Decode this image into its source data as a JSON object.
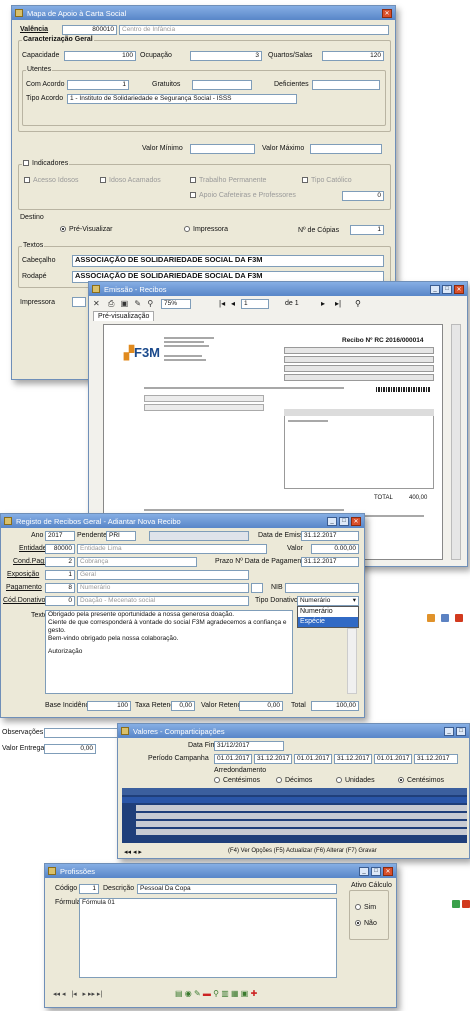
{
  "w1": {
    "title": "Mapa de Apoio à Carta Social",
    "valencia_label": "Valência",
    "valencia_code": "800010",
    "valencia_name": "Centro de Infância",
    "carac_label": "Caracterização Geral",
    "capacidade_label": "Capacidade",
    "capacidade": "100",
    "ocupacao_label": "Ocupação",
    "ocupacao": "3",
    "quartos_label": "Quartos/Salas",
    "quartos": "120",
    "utentes_label": "Utentes",
    "com_acordo_label": "Com Acordo",
    "com_acordo": "1",
    "gratuitos_label": "Gratuitos",
    "deficientes_label": "Deficientes",
    "tipo_acordo_label": "Tipo Acordo",
    "tipo_acordo": "1 - Instituto de Solidariedade e Segurança Social - ISSS",
    "valor_minimo_label": "Valor Mínimo",
    "valor_maximo_label": "Valor Máximo",
    "indicadores_label": "Indicadores",
    "ind1": "Acesso Idosos",
    "ind2": "Idoso Acamados",
    "ind3": "Trabalho Permanente",
    "ind4": "Tipo Católico",
    "ind5": "Apoio Cafeteiras e Professores",
    "ind_value": "0",
    "destino_label": "Destino",
    "pre_visualizar": "Pré-Visualizar",
    "impressora_opt": "Impressora",
    "copias_label": "Nº de Cópias",
    "copias": "1",
    "textos_label": "Textos",
    "cabecalho_label": "Cabeçalho",
    "cabecalho": "ASSOCIAÇÃO DE SOLIDARIEDADE SOCIAL DA F3M",
    "rodape_label": "Rodapé",
    "rodape": "ASSOCIAÇÃO DE SOLIDARIEDADE SOCIAL DA F3M",
    "impressora_label": "Impressora"
  },
  "w2": {
    "title": "Emissão - Recibos",
    "zoom": "75%",
    "page": "1",
    "pages": "de 1",
    "tab": "Pré-visualização",
    "logo": "F3M",
    "doc_title": "Recibo Nº",
    "doc_number": "RC 2016/000014",
    "total_label": "TOTAL",
    "total": "400,00"
  },
  "w3": {
    "title": "Registo de Recibos Geral - Adiantar Nova Recibo",
    "ano_label": "Ano",
    "ano": "2017",
    "estado_label": "Estado",
    "estado": "Pendente",
    "serie": "PRI",
    "data_emissao_label": "Data de Emissão",
    "data_emissao": "31.12.2017",
    "entidade_label": "Entidade",
    "entidade_code": "80000",
    "entidade_name": "Entidade Lima",
    "valor_label": "Valor",
    "valor": "0.00,00",
    "cond_pag_label": "Cond.Pag.",
    "cond_pag_code": "2",
    "cond_pag_name": "Cobrança",
    "prazo_label": "Prazo Nº Data de Pagamento",
    "prazo": "31.12.2017",
    "exposicao_label": "Exposição",
    "exposicao_code": "1",
    "exposicao_name": "Geral",
    "pagamento_label": "Pagamento",
    "pagamento_code": "8",
    "pagamento_name": "Numerário",
    "nib_label": "NIB",
    "cod_donativo_label": "Cód.Donativo",
    "cod_donativo_code": "0",
    "cod_donativo_name": "Doação - Mecenato social",
    "tipo_donativo_label": "Tipo Donativo",
    "tipo_donativo": "Numerário",
    "opt_numerario": "Numerário",
    "opt_especie": "Espécie",
    "texto_label": "Texto",
    "texto1": "Obrigado pela presente oportunidade a nossa generosa doação.",
    "texto2": "Ciente de que corresponderá à vontade do social F3M agradecemos a confiança e gesto.",
    "texto3": "Bem-vindo obrigado pela nossa colaboração.",
    "texto4": "Autorização",
    "base_label": "Base Incidência",
    "base": "100",
    "taxa_label": "Taxa Retenção",
    "taxa": "0,00",
    "valor_retido_label": "Valor Retenção",
    "valor_retido": "0,00",
    "total_label": "Total",
    "total": "100,00",
    "observacoes_label": "Observações",
    "valor_entrega_label": "Valor Entrega",
    "valor_entrega": "0,00"
  },
  "w4": {
    "title": "Valores - Comparticipações",
    "data_fim_label": "Data Fim",
    "data_fim": "31/12/2017",
    "periodo_label": "Período Campanha",
    "p1": "01.01.2017",
    "p2": "31.12.2017",
    "p3": "01.01.2017",
    "p4": "31.12.2017",
    "p5": "01.01.2017",
    "p6": "31.12.2017",
    "arred_label": "Arredondamento",
    "r1": "Centésimos",
    "r2": "Décimos",
    "r3": "Unidades",
    "r4": "Centésimos",
    "footer": "(F4) Ver Opções  (F5) Actualizar  (F6) Alterar  (F7) Gravar"
  },
  "w5": {
    "title": "Profissões",
    "codigo_label": "Código",
    "codigo": "1",
    "descricao_label": "Descrição",
    "descricao": "Pessoal Da Copa",
    "formula_label": "Fórmula",
    "formula": "Fórmula 01",
    "ativo_label": "Ativo Cálculo",
    "sim": "Sim",
    "nao": "Não"
  }
}
